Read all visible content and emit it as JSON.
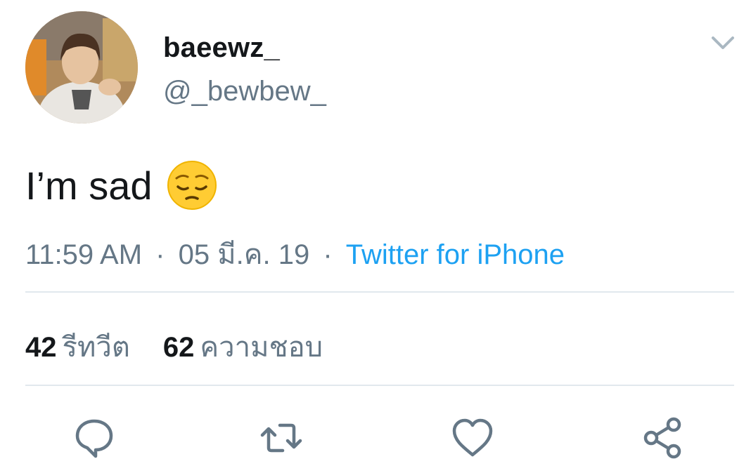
{
  "user": {
    "display_name": "baeewz_",
    "handle": "@_bewbew_"
  },
  "tweet": {
    "text": "I’m sad",
    "emoji": "pensive-face-emoji"
  },
  "meta": {
    "time": "11:59 AM",
    "separator": "·",
    "date": "05 มี.ค. 19",
    "source": "Twitter for iPhone"
  },
  "stats": {
    "retweets_count": "42",
    "retweets_label": "รีทวีต",
    "likes_count": "62",
    "likes_label": "ความชอบ"
  },
  "actions": [
    {
      "icon": "reply-icon"
    },
    {
      "icon": "retweet-icon"
    },
    {
      "icon": "like-icon"
    },
    {
      "icon": "share-icon"
    }
  ],
  "colors": {
    "text_primary": "#14171a",
    "text_secondary": "#657786",
    "link": "#1da1f2",
    "divider": "#e1e8ed"
  }
}
